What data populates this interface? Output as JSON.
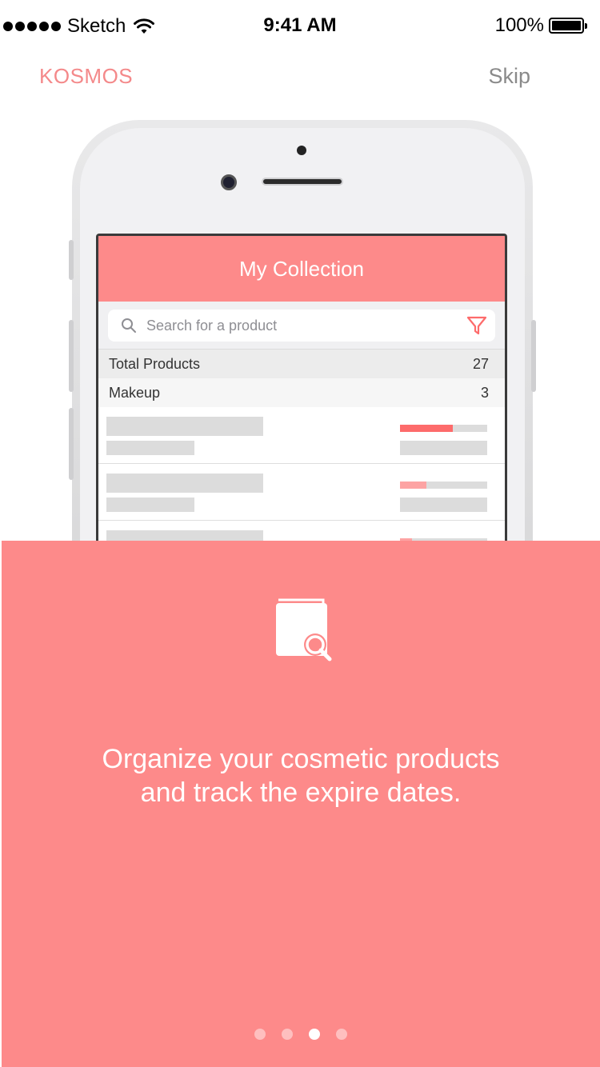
{
  "status_bar": {
    "carrier": "Sketch",
    "time": "9:41 AM",
    "battery": "100%",
    "icons": [
      "signal-dots-icon",
      "wifi-icon",
      "battery-icon"
    ]
  },
  "nav": {
    "brand": "KOSMOS",
    "skip_label": "Skip"
  },
  "mockup_screen": {
    "title": "My Collection",
    "search_placeholder": "Search for a product",
    "total_label": "Total Products",
    "total_value": "27",
    "makeup_label": "Makeup",
    "makeup_value": "3",
    "items": [
      {
        "progress": 0.61,
        "color": "#fd6b6b"
      },
      {
        "progress": 0.3,
        "color": "#fda3a3"
      },
      {
        "progress": 0.14,
        "color": "#fda3a3"
      }
    ]
  },
  "onboarding": {
    "icon": "book-search-icon",
    "message": "Organize your cosmetic products and track the expire dates.",
    "page_count": 4,
    "active_page": 3
  },
  "colors": {
    "accent": "#fd8a8a",
    "brand_text": "#f4898a",
    "skip_text": "#8a8a8a"
  }
}
